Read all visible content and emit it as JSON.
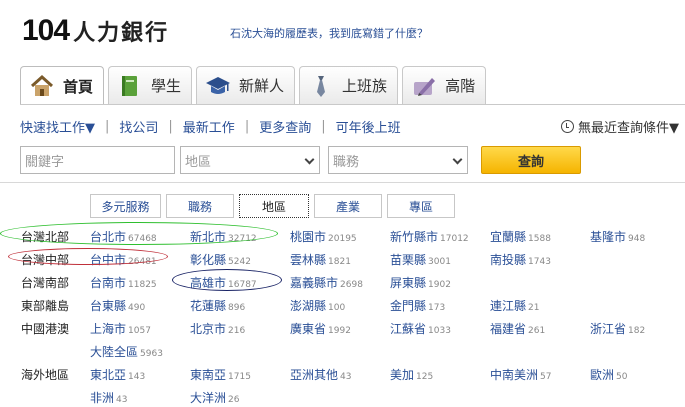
{
  "header": {
    "logo_num": "104",
    "logo_text": "人力銀行",
    "slogan": "石沈大海的履歷表，我到底寫錯了什麼？"
  },
  "tabs": [
    {
      "label": "首頁",
      "icon": "house-icon",
      "active": true
    },
    {
      "label": "學生",
      "icon": "book-icon",
      "active": false
    },
    {
      "label": "新鮮人",
      "icon": "graduation-cap-icon",
      "active": false
    },
    {
      "label": "上班族",
      "icon": "necktie-icon",
      "active": false
    },
    {
      "label": "高階",
      "icon": "pen-icon",
      "active": false
    }
  ],
  "nav": {
    "items": [
      "快速找工作▼",
      "找公司",
      "最新工作",
      "更多查詢",
      "可年後上班"
    ],
    "history": "無最近查詢條件▼"
  },
  "search": {
    "keyword_placeholder": "關鍵字",
    "area_value": "地區",
    "industry_value": "職務",
    "button": "查詢"
  },
  "subtabs": [
    "多元服務",
    "職務",
    "地區",
    "產業",
    "專區"
  ],
  "regions": [
    {
      "label": "台灣北部",
      "cities": [
        {
          "name": "台北市",
          "count": "67468"
        },
        {
          "name": "新北市",
          "count": "32712"
        },
        {
          "name": "桃園市",
          "count": "20195"
        },
        {
          "name": "新竹縣市",
          "count": "17012"
        },
        {
          "name": "宜蘭縣",
          "count": "1588"
        },
        {
          "name": "基隆市",
          "count": "948"
        }
      ]
    },
    {
      "label": "台灣中部",
      "cities": [
        {
          "name": "台中市",
          "count": "26481"
        },
        {
          "name": "彰化縣",
          "count": "5242"
        },
        {
          "name": "雲林縣",
          "count": "1821"
        },
        {
          "name": "苗栗縣",
          "count": "3001"
        },
        {
          "name": "南投縣",
          "count": "1743"
        }
      ]
    },
    {
      "label": "台灣南部",
      "cities": [
        {
          "name": "台南市",
          "count": "11825"
        },
        {
          "name": "高雄市",
          "count": "16787"
        },
        {
          "name": "嘉義縣市",
          "count": "2698"
        },
        {
          "name": "屏東縣",
          "count": "1902"
        }
      ]
    },
    {
      "label": "東部離島",
      "cities": [
        {
          "name": "台東縣",
          "count": "490"
        },
        {
          "name": "花蓮縣",
          "count": "896"
        },
        {
          "name": "澎湖縣",
          "count": "100"
        },
        {
          "name": "金門縣",
          "count": "173"
        },
        {
          "name": "連江縣",
          "count": "21"
        }
      ]
    },
    {
      "label": "中國港澳",
      "cities": [
        {
          "name": "上海市",
          "count": "1057"
        },
        {
          "name": "北京市",
          "count": "216"
        },
        {
          "name": "廣東省",
          "count": "1992"
        },
        {
          "name": "江蘇省",
          "count": "1033"
        },
        {
          "name": "福建省",
          "count": "261"
        },
        {
          "name": "浙江省",
          "count": "182"
        },
        {
          "name": "大陸全區",
          "count": "5963"
        }
      ]
    },
    {
      "label": "海外地區",
      "cities": [
        {
          "name": "東北亞",
          "count": "143"
        },
        {
          "name": "東南亞",
          "count": "1715"
        },
        {
          "name": "亞洲其他",
          "count": "43"
        },
        {
          "name": "美加",
          "count": "125"
        },
        {
          "name": "中南美洲",
          "count": "57"
        },
        {
          "name": "歐洲",
          "count": "50"
        },
        {
          "name": "非洲",
          "count": "43"
        },
        {
          "name": "大洋洲",
          "count": "26"
        }
      ]
    }
  ],
  "colors": {
    "link": "#2a4f96",
    "accent_button": "#f5b400",
    "annotation_green": "#2fbf2f",
    "annotation_red": "#c0303a",
    "annotation_navy": "#1a2466"
  }
}
